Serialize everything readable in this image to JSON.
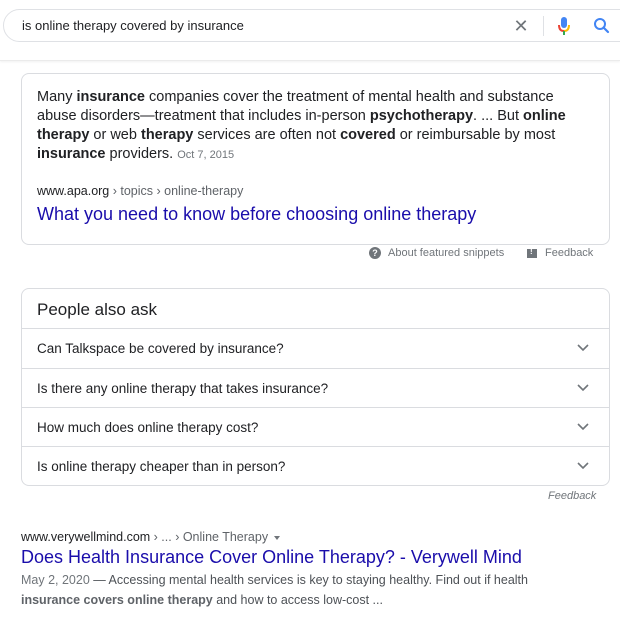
{
  "search": {
    "query": "is online therapy covered by insurance",
    "clear_icon": "close-icon",
    "mic_icon": "microphone-icon",
    "search_icon": "search-icon"
  },
  "featured_snippet": {
    "segments": [
      {
        "text": "Many ",
        "bold": false
      },
      {
        "text": "insurance",
        "bold": true
      },
      {
        "text": " companies cover the treatment of mental health and substance abuse disorders—treatment that includes in-person ",
        "bold": false
      },
      {
        "text": "psychotherapy",
        "bold": true
      },
      {
        "text": ". ... But ",
        "bold": false
      },
      {
        "text": "online therapy",
        "bold": true
      },
      {
        "text": " or web ",
        "bold": false
      },
      {
        "text": "therapy",
        "bold": true
      },
      {
        "text": " services are often not ",
        "bold": false
      },
      {
        "text": "covered",
        "bold": true
      },
      {
        "text": " or reimbursable by most ",
        "bold": false
      },
      {
        "text": "insurance",
        "bold": true
      },
      {
        "text": " providers.",
        "bold": false
      }
    ],
    "date": "Oct 7, 2015",
    "url_domain": "www.apa.org",
    "url_path": " › topics › online-therapy",
    "title": "What you need to know before choosing online therapy"
  },
  "snippet_footer": {
    "about_label": "About featured snippets",
    "feedback_label": "Feedback"
  },
  "people_also_ask": {
    "title": "People also ask",
    "questions": [
      "Can Talkspace be covered by insurance?",
      "Is there any online therapy that takes insurance?",
      "How much does online therapy cost?",
      "Is online therapy cheaper than in person?"
    ],
    "feedback_label": "Feedback"
  },
  "result": {
    "url_domain": "www.verywellmind.com",
    "url_path": " › ... › Online Therapy",
    "title": "Does Health Insurance Cover Online Therapy? - Verywell Mind",
    "date": "May 2, 2020",
    "desc_part1": " — Accessing mental health services is key to staying healthy. Find out if health ",
    "desc_bold": "insurance covers online therapy",
    "desc_part2": " and how to access low-cost ..."
  },
  "colors": {
    "link": "#1a0dab",
    "muted": "#70757a",
    "border": "#dadce0"
  }
}
